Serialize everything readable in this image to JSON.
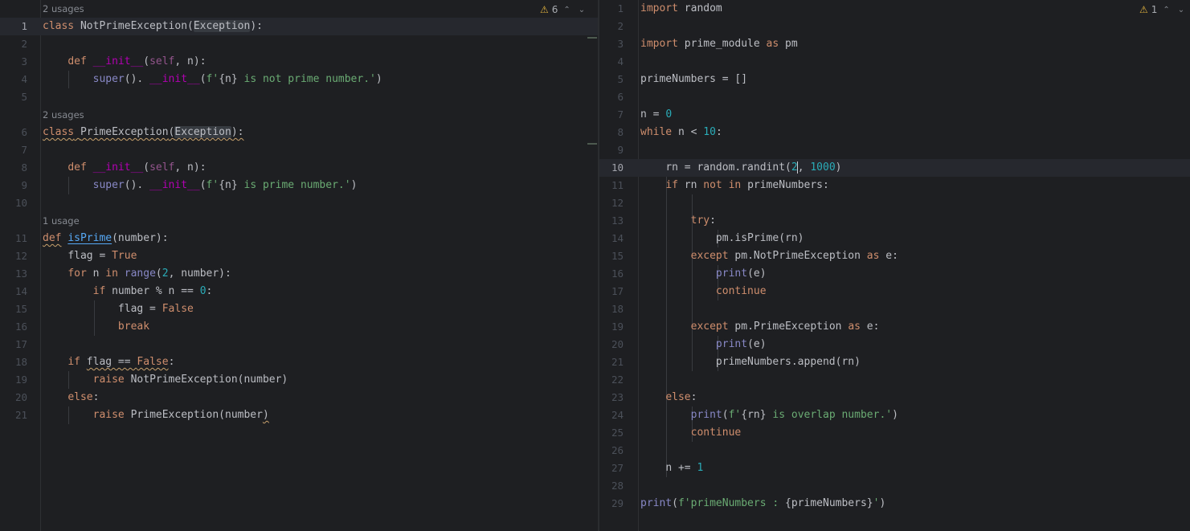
{
  "left_editor": {
    "warnings_count": "6",
    "warning_icon": "warning-triangle-icon",
    "usages": {
      "u1": "2 usages",
      "u2": "2 usages",
      "u3": "1 usage"
    },
    "line_numbers": [
      "1",
      "2",
      "3",
      "4",
      "5",
      "6",
      "7",
      "8",
      "9",
      "10",
      "11",
      "12",
      "13",
      "14",
      "15",
      "16",
      "17",
      "18",
      "19",
      "20",
      "21"
    ],
    "code": {
      "l1_kw": "class",
      "l1_name": "NotPrimeException(",
      "l1_base": "Exception",
      "l1_end": "):",
      "l3_kw": "def",
      "l3_fn": "__init__",
      "l3_open": "(",
      "l3_self": "self",
      "l3_rest": ", n):",
      "l4_super": "super",
      "l4_mid": "(). ",
      "l4_init": "__init__",
      "l4_open": "(",
      "l4_s1": "f'",
      "l4_interp": "{n}",
      "l4_s2": " is not prime number.'",
      "l4_end": ")",
      "l6_kw": "class",
      "l6_name": "PrimeException",
      "l6_open": "(",
      "l6_base": "Exception",
      "l6_end": "):",
      "l8_kw": "def",
      "l8_fn": "__init__",
      "l8_open": "(",
      "l8_self": "self",
      "l8_rest": ", n):",
      "l9_super": "super",
      "l9_mid": "(). ",
      "l9_init": "__init__",
      "l9_open": "(",
      "l9_s1": "f'",
      "l9_interp": "{n}",
      "l9_s2": " is prime number.'",
      "l9_end": ")",
      "l11_kw": "def",
      "l11_fn": "isPrime",
      "l11_rest": "(number):",
      "l12_a": "flag = ",
      "l12_b": "True",
      "l13_kw": "for",
      "l13_a": " n ",
      "l13_in": "in",
      "l13_sp": " ",
      "l13_range": "range",
      "l13_open": "(",
      "l13_num": "2",
      "l13_rest": ", number):",
      "l14_kw": "if",
      "l14_a": " number % n == ",
      "l14_num": "0",
      "l14_end": ":",
      "l15_a": "flag = ",
      "l15_b": "False",
      "l16_kw": "break",
      "l18_kw": "if",
      "l18_sp": " ",
      "l18_a": "flag == ",
      "l18_b": "False",
      "l18_end": ":",
      "l19_kw": "raise",
      "l19_rest": " NotPrimeException(number)",
      "l20_kw": "else",
      "l20_end": ":",
      "l21_kw": "raise",
      "l21_rest": " PrimeException(number",
      "l21_end": ")"
    }
  },
  "right_editor": {
    "warnings_count": "1",
    "warning_icon": "warning-triangle-icon",
    "line_numbers": [
      "1",
      "2",
      "3",
      "4",
      "5",
      "6",
      "7",
      "8",
      "9",
      "10",
      "11",
      "12",
      "13",
      "14",
      "15",
      "16",
      "17",
      "18",
      "19",
      "20",
      "21",
      "22",
      "23",
      "24",
      "25",
      "26",
      "27",
      "28",
      "29"
    ],
    "code": {
      "r1_kw": "import",
      "r1_rest": " random",
      "r3_kw": "import",
      "r3_a": " prime_module ",
      "r3_as": "as",
      "r3_b": " pm",
      "r5": "primeNumbers = []",
      "r7_a": "n = ",
      "r7_num": "0",
      "r8_kw": "while",
      "r8_a": " n < ",
      "r8_num": "10",
      "r8_end": ":",
      "r10_a": "rn = random.randint(",
      "r10_num1": "2",
      "r10_comma": ", ",
      "r10_num2": "1000",
      "r10_end": ")",
      "r11_kw": "if",
      "r11_a": " rn ",
      "r11_kw2": "not in",
      "r11_b": " primeNumbers:",
      "r13_kw": "try",
      "r13_end": ":",
      "r14": "pm.isPrime(rn)",
      "r15_kw": "except",
      "r15_a": " pm.NotPrimeException ",
      "r15_as": "as",
      "r15_b": " e:",
      "r16_print": "print",
      "r16_rest": "(e)",
      "r17_kw": "continue",
      "r19_kw": "except",
      "r19_a": " pm.PrimeException ",
      "r19_as": "as",
      "r19_b": " e:",
      "r20_print": "print",
      "r20_rest": "(e)",
      "r21": "primeNumbers.append(rn)",
      "r23_kw": "else",
      "r23_end": ":",
      "r24_print": "print",
      "r24_open": "(",
      "r24_s1": "f'",
      "r24_interp": "{rn}",
      "r24_s2": " is overlap number.'",
      "r24_end": ")",
      "r25_kw": "continue",
      "r27_a": "n += ",
      "r27_num": "1",
      "r29_print": "print",
      "r29_open": "(",
      "r29_s1": "f'primeNumbers : ",
      "r29_interp": "{primeNumbers}",
      "r29_s2": "'",
      "r29_end": ")"
    }
  }
}
